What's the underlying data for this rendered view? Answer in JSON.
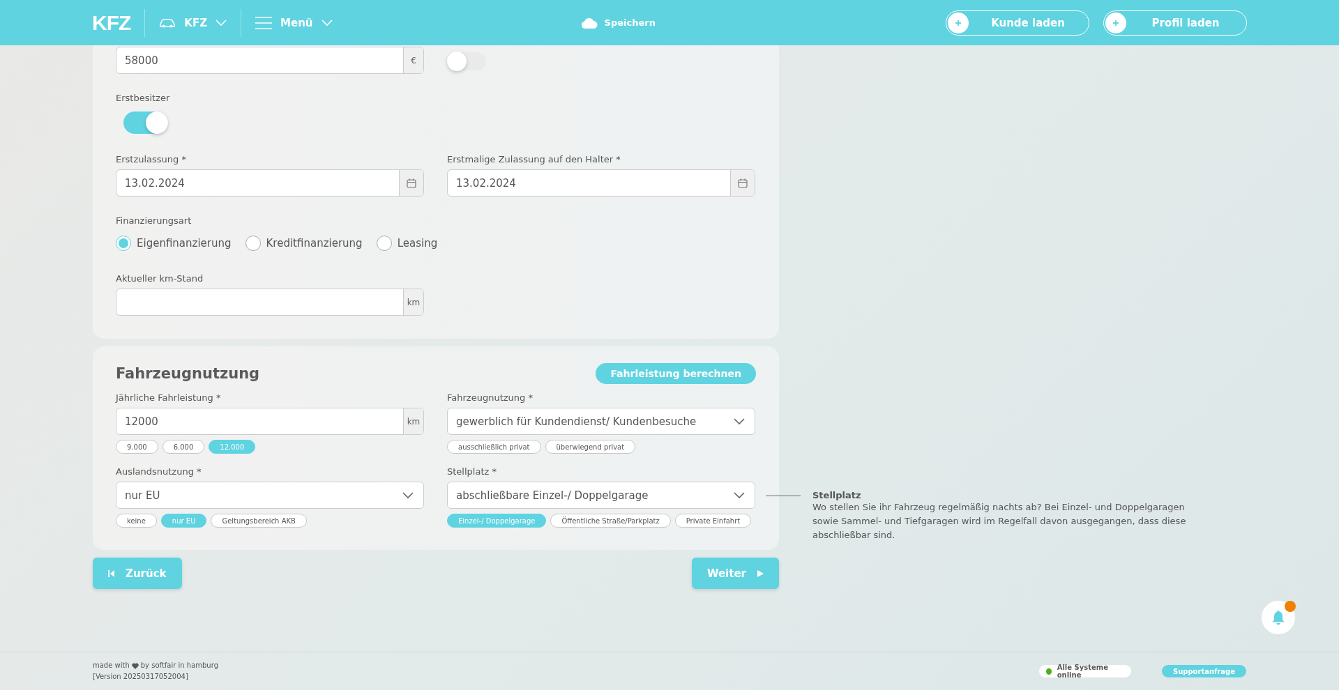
{
  "header": {
    "logo": "KFZ",
    "product_menu": {
      "label": "KFZ"
    },
    "main_menu": {
      "label": "Menü"
    },
    "save": {
      "label": "Speichern"
    },
    "actions": [
      {
        "label": "Kunde laden"
      },
      {
        "label": "Profil laden"
      }
    ]
  },
  "vehicle_card": {
    "price_field": {
      "value": "58000",
      "unit": "€"
    },
    "unlabeled_toggle": {
      "on": false
    },
    "first_owner": {
      "label": "Erstbesitzer",
      "on": true
    },
    "dates": [
      {
        "label": "Erstzulassung *",
        "value": "13.02.2024"
      },
      {
        "label": "Erstmalige Zulassung auf den Halter *",
        "value": "13.02.2024"
      }
    ],
    "financing": {
      "label": "Finanzierungsart",
      "options": [
        {
          "label": "Eigenfinanzierung",
          "selected": true
        },
        {
          "label": "Kreditfinanzierung",
          "selected": false
        },
        {
          "label": "Leasing",
          "selected": false
        }
      ]
    },
    "mileage": {
      "label": "Aktueller km-Stand",
      "unit": "km"
    }
  },
  "usage_card": {
    "title": "Fahrzeugnutzung",
    "calc_button": "Fahrleistung berechnen",
    "fields": [
      {
        "kind": "input",
        "label": "Jährliche Fahrleistung *",
        "value": "12000",
        "unit": "km",
        "chips": [
          {
            "label": "9.000",
            "selected": false
          },
          {
            "label": "6.000",
            "selected": false
          },
          {
            "label": "12.000",
            "selected": true
          }
        ]
      },
      {
        "kind": "select",
        "label": "Fahrzeugnutzung *",
        "value": "gewerblich für Kundendienst/ Kundenbesuche",
        "chips": [
          {
            "label": "ausschließlich privat",
            "selected": false
          },
          {
            "label": "überwiegend privat",
            "selected": false
          }
        ]
      },
      {
        "kind": "select",
        "label": "Auslandsnutzung *",
        "value": "nur EU",
        "chips": [
          {
            "label": "keine",
            "selected": false
          },
          {
            "label": "nur EU",
            "selected": true
          },
          {
            "label": "Geltungsbereich AKB",
            "selected": false
          }
        ]
      },
      {
        "kind": "select",
        "label": "Stellplatz *",
        "value": "abschließbare Einzel-/ Doppelgarage",
        "chips": [
          {
            "label": "Einzel-/ Doppelgarage",
            "selected": true
          },
          {
            "label": "Öffentliche Straße/Parkplatz",
            "selected": false
          },
          {
            "label": "Private Einfahrt",
            "selected": false
          }
        ]
      }
    ]
  },
  "help": {
    "title": "Stellplatz",
    "text": "Wo stellen Sie ihr Fahrzeug regelmäßig nachts ab? Bei Einzel- und Doppelgaragen sowie Sammel- und Tiefgaragen wird im Regelfall davon ausgegangen, dass diese abschließbar sind."
  },
  "navigation": {
    "back": "Zurück",
    "next": "Weiter"
  },
  "footer": {
    "made_with": "made with",
    "made_by": "by softfair in hamburg",
    "version": "[Version 20250317052004]",
    "status": {
      "label": "Alle Systeme online",
      "color": "#4caf1a"
    },
    "support": "Supportanfrage"
  }
}
